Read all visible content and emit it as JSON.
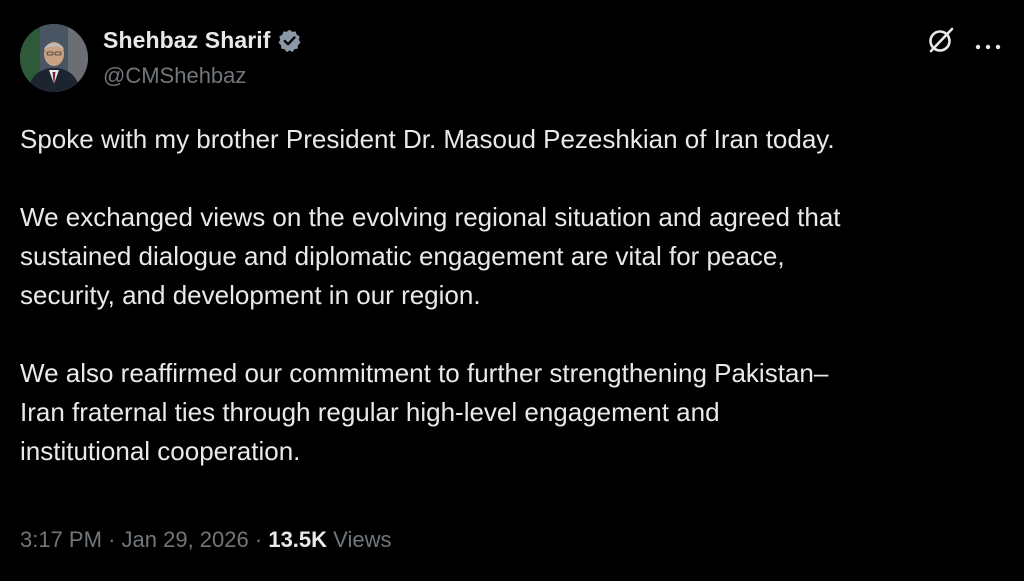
{
  "author": {
    "display_name": "Shehbaz Sharif",
    "handle": "@CMShehbaz",
    "verified": true,
    "avatar_icon": "profile-photo",
    "verified_icon": "verified-badge-icon"
  },
  "header_actions": {
    "grok_icon": "grok-slash-circle-icon",
    "more_icon": "more-dots-icon"
  },
  "tweet": {
    "paragraphs": [
      {
        "lines": [
          "Spoke with my brother President Dr. Masoud Pezeshkian of Iran today."
        ]
      },
      {
        "lines": [
          "We exchanged views on the evolving regional situation and agreed that",
          "sustained dialogue and diplomatic engagement are vital for peace,",
          "security, and development in our region."
        ]
      },
      {
        "lines": [
          "We also reaffirmed our commitment to further strengthening Pakistan–",
          "Iran fraternal ties through regular high-level engagement and",
          "institutional cooperation."
        ]
      }
    ]
  },
  "meta": {
    "time": "3:17 PM",
    "separator": "·",
    "date": "Jan 29, 2026",
    "views_count": "13.5K",
    "views_label": "Views"
  },
  "colors": {
    "background": "#000000",
    "primary_text": "#e7e9ea",
    "secondary_text": "#71767b",
    "verified_badge": "#8b98a5"
  }
}
